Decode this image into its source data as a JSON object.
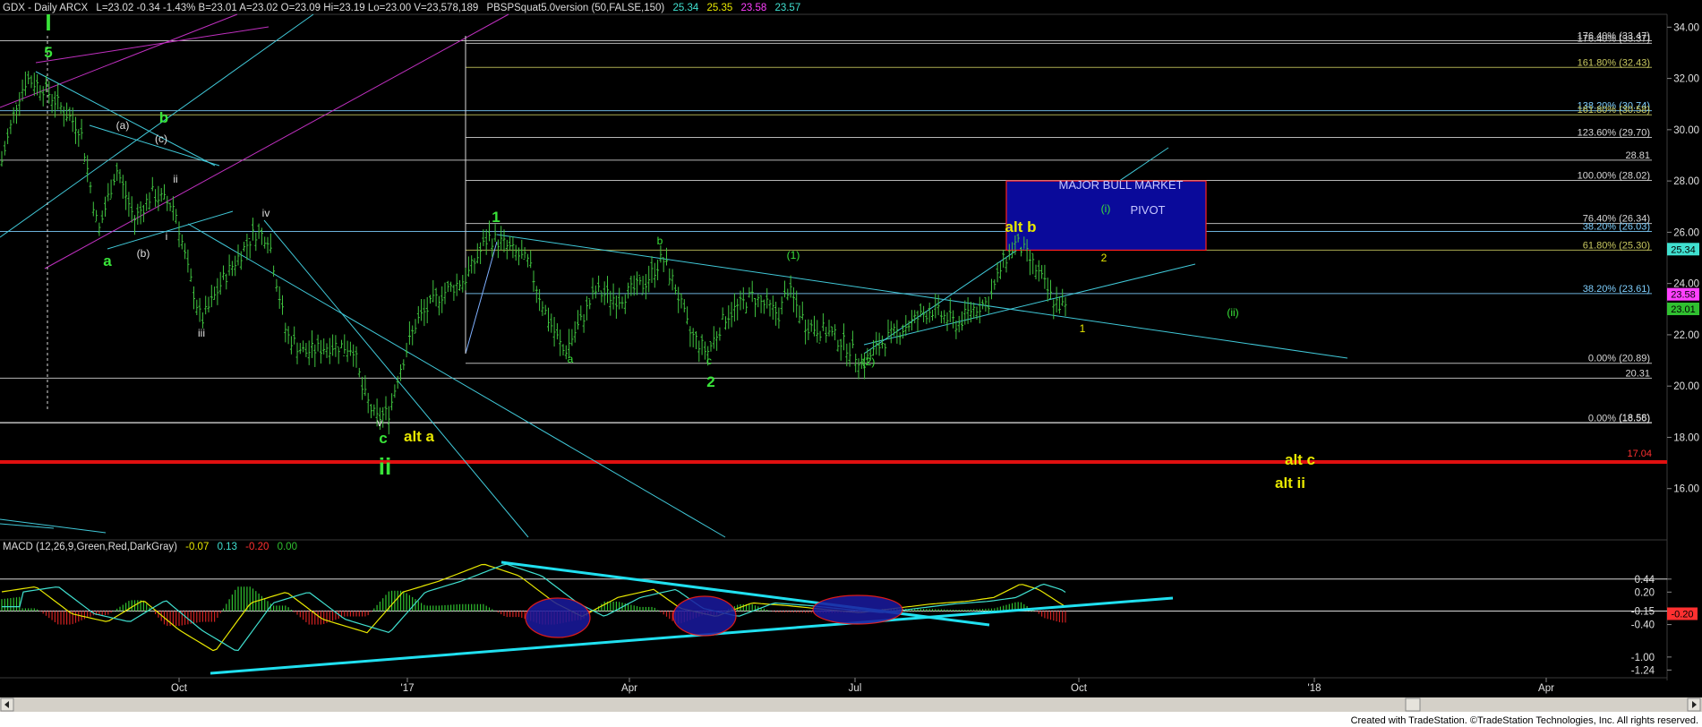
{
  "header": {
    "symbol": "GDX - Daily ARCX",
    "ohlc": "L=23.02 -0.34 -1.43% B=23.01 A=23.02 O=23.09 Hi=23.19 Lo=23.00 V=23,578,189",
    "study": "PBSPSquat5.0version (50,FALSE,150)",
    "study_values": [
      "25.34",
      "25.35",
      "23.58",
      "23.57"
    ],
    "study_colors": [
      "#40e0d0",
      "#e8e800",
      "#ff40ff",
      "#40e0d0"
    ]
  },
  "macd_header": {
    "label": "MACD (12,26,9,Green,Red,DarkGray)",
    "values": [
      "-0.07",
      "0.13",
      "-0.20",
      "0.00"
    ],
    "colors": [
      "#e8e800",
      "#40e0d0",
      "#ff3030",
      "#30c030"
    ]
  },
  "footer": {
    "credit": "Created with TradeStation. ©TradeStation Technologies, Inc. All rights reserved."
  },
  "colors": {
    "background": "#000000",
    "bars": "#3fc23f",
    "trendline": "#40c8d8",
    "channel": "#c030c0",
    "support": "#e01010",
    "wave_green": "#39e339",
    "wave_yellow": "#e8e800",
    "pivot_fill": "#0a0a9a",
    "pivot_border": "#ff2020"
  },
  "chart_data": [
    {
      "type": "ohlc",
      "title": "GDX - Daily ARCX",
      "x_ticks": [
        "Oct",
        "'17",
        "Apr",
        "Jul",
        "Oct",
        "'18",
        "Apr"
      ],
      "y_ticks": [
        "16.00",
        "18.00",
        "20.00",
        "22.00",
        "24.00",
        "26.00",
        "28.00",
        "30.00",
        "32.00",
        "34.00"
      ],
      "ylim": [
        14.0,
        34.5
      ],
      "last_close": 23.01,
      "price_flags": [
        {
          "label": "25.34",
          "value": 25.34,
          "color": "#40e0d0"
        },
        {
          "label": "23.58",
          "value": 23.58,
          "color": "#ff40ff"
        },
        {
          "label": "23.01",
          "value": 23.01,
          "color": "#30c030"
        }
      ],
      "fib_levels": [
        {
          "label": "176.40% (33.47)",
          "value": 33.47
        },
        {
          "label": "176.40% (33.37)",
          "value": 33.37
        },
        {
          "label": "161.80% (32.43)",
          "value": 32.43
        },
        {
          "label": "138.20% (30.74)",
          "value": 30.74
        },
        {
          "label": "161.80% (30.58)",
          "value": 30.58
        },
        {
          "label": "123.60% (29.70)",
          "value": 29.7
        },
        {
          "label": "28.81",
          "value": 28.81
        },
        {
          "label": "100.00% (28.02)",
          "value": 28.02
        },
        {
          "label": "76.40% (26.34)",
          "value": 26.34
        },
        {
          "label": "38.20% (26.03)",
          "value": 26.03
        },
        {
          "label": "61.80% (25.30)",
          "value": 25.3
        },
        {
          "label": "38.20% (23.61)",
          "value": 23.61
        },
        {
          "label": "0.00% (20.89)",
          "value": 20.89
        },
        {
          "label": "20.31",
          "value": 20.31
        },
        {
          "label": "0.00% (18.56)",
          "value": 18.56
        },
        {
          "label": "(18.58)",
          "value": 18.58
        },
        {
          "label": "17.04",
          "value": 17.04
        }
      ],
      "pivot_box": {
        "label_1": "MAJOR BULL MARKET",
        "label_2": "PIVOT",
        "top": 28.0,
        "bottom": 25.3
      },
      "wave_labels": [
        {
          "text": "I",
          "color": "green",
          "size": "large"
        },
        {
          "text": "5",
          "color": "green",
          "size": "medium"
        },
        {
          "text": "b",
          "color": "green",
          "size": "medium"
        },
        {
          "text": "a",
          "color": "green",
          "size": "medium"
        },
        {
          "text": "(a)",
          "color": "white",
          "size": "small"
        },
        {
          "text": "(c)",
          "color": "white",
          "size": "small"
        },
        {
          "text": "ii",
          "color": "white",
          "size": "small"
        },
        {
          "text": "i",
          "color": "white",
          "size": "small"
        },
        {
          "text": "(b)",
          "color": "white",
          "size": "small"
        },
        {
          "text": "iv",
          "color": "white",
          "size": "small"
        },
        {
          "text": "iii",
          "color": "white",
          "size": "small"
        },
        {
          "text": "v",
          "color": "white",
          "size": "small"
        },
        {
          "text": "c",
          "color": "green",
          "size": "medium"
        },
        {
          "text": "ii",
          "color": "green",
          "size": "large"
        },
        {
          "text": "alt a",
          "color": "yellow",
          "size": "medium"
        },
        {
          "text": "1",
          "color": "green",
          "size": "medium"
        },
        {
          "text": "a",
          "color": "green",
          "size": "small"
        },
        {
          "text": "b",
          "color": "green",
          "size": "small"
        },
        {
          "text": "c",
          "color": "green",
          "size": "small"
        },
        {
          "text": "2",
          "color": "green",
          "size": "medium"
        },
        {
          "text": "(1)",
          "color": "green",
          "size": "small"
        },
        {
          "text": "(2)",
          "color": "green",
          "size": "small"
        },
        {
          "text": "alt b",
          "color": "yellow",
          "size": "medium"
        },
        {
          "text": "(i)",
          "color": "green",
          "size": "small"
        },
        {
          "text": "2",
          "color": "yellow",
          "size": "small"
        },
        {
          "text": "1",
          "color": "yellow",
          "size": "small"
        },
        {
          "text": "(ii)",
          "color": "green",
          "size": "small"
        },
        {
          "text": "alt c",
          "color": "yellow",
          "size": "medium"
        },
        {
          "text": "alt ii",
          "color": "yellow",
          "size": "medium"
        }
      ]
    },
    {
      "type": "macd",
      "title": "MACD (12,26,9,Green,Red,DarkGray)",
      "y_ticks": [
        "0.44",
        "0.20",
        "-0.15",
        "-0.40",
        "-1.00",
        "-1.24"
      ],
      "ylim": [
        -1.3,
        0.85
      ],
      "price_flags": [
        {
          "label": "-0.20",
          "value": -0.2,
          "color": "#ff3030"
        }
      ],
      "levels": [
        0.44,
        -0.15
      ]
    }
  ]
}
